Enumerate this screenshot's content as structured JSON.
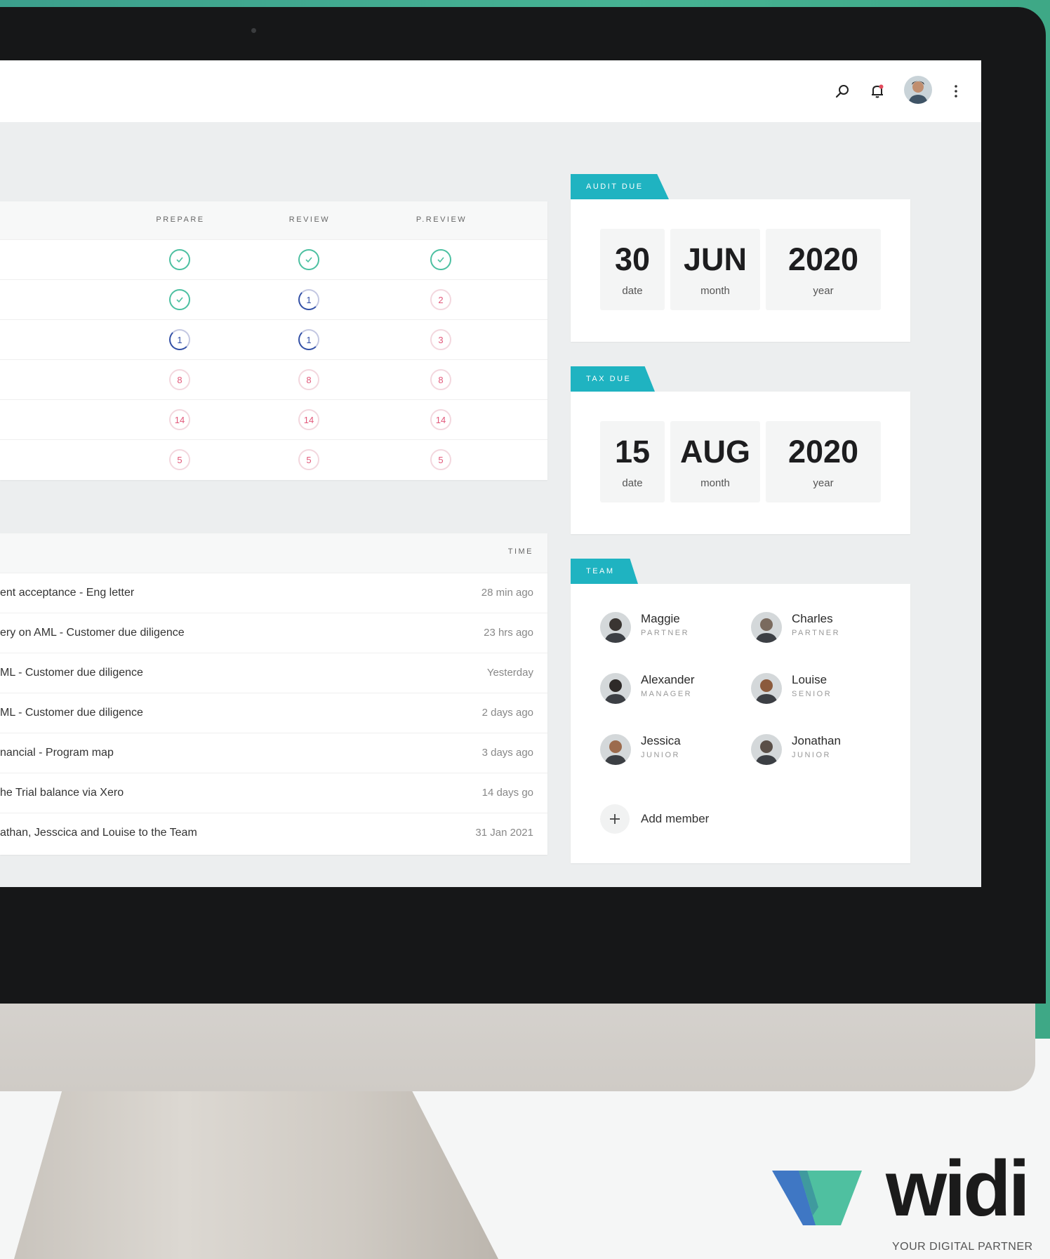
{
  "header": {
    "icons": [
      "search-icon",
      "bell-icon",
      "user-avatar",
      "more-vertical-icon"
    ]
  },
  "status_table": {
    "columns": [
      "PREPARE",
      "REVIEW",
      "P.REVIEW"
    ],
    "rows": [
      [
        {
          "type": "done",
          "label": ""
        },
        {
          "type": "done",
          "label": ""
        },
        {
          "type": "done",
          "label": ""
        }
      ],
      [
        {
          "type": "done",
          "label": ""
        },
        {
          "type": "progress",
          "label": "1"
        },
        {
          "type": "count",
          "label": "2"
        }
      ],
      [
        {
          "type": "progress",
          "label": "1"
        },
        {
          "type": "progress",
          "label": "1"
        },
        {
          "type": "count",
          "label": "3"
        }
      ],
      [
        {
          "type": "count",
          "label": "8"
        },
        {
          "type": "count",
          "label": "8"
        },
        {
          "type": "count",
          "label": "8"
        }
      ],
      [
        {
          "type": "count",
          "label": "14"
        },
        {
          "type": "count",
          "label": "14"
        },
        {
          "type": "count",
          "label": "14"
        }
      ],
      [
        {
          "type": "count",
          "label": "5"
        },
        {
          "type": "count",
          "label": "5"
        },
        {
          "type": "count",
          "label": "5"
        }
      ]
    ]
  },
  "activity": {
    "time_header": "TIME",
    "items": [
      {
        "text": "ent acceptance - Eng letter",
        "time": "28 min ago"
      },
      {
        "text": "ery on AML - Customer due diligence",
        "time": "23 hrs ago"
      },
      {
        "text": "ML - Customer due diligence",
        "time": "Yesterday"
      },
      {
        "text": "ML - Customer due diligence",
        "time": "2 days ago"
      },
      {
        "text": "nancial - Program map",
        "time": "3 days ago"
      },
      {
        "text": "he Trial balance via Xero",
        "time": "14 days go"
      },
      {
        "text": "athan, Jesscica and Louise to the Team",
        "time": "31 Jan 2021"
      }
    ]
  },
  "audit_due": {
    "tag": "AUDIT DUE",
    "date": "30",
    "date_label": "date",
    "month": "JUN",
    "month_label": "month",
    "year": "2020",
    "year_label": "year"
  },
  "tax_due": {
    "tag": "TAX DUE",
    "date": "15",
    "date_label": "date",
    "month": "AUG",
    "month_label": "month",
    "year": "2020",
    "year_label": "year"
  },
  "team": {
    "tag": "TEAM",
    "members": [
      {
        "name": "Maggie",
        "role": "PARTNER",
        "color": "#3a3532"
      },
      {
        "name": "Charles",
        "role": "PARTNER",
        "color": "#7a6a5e"
      },
      {
        "name": "Alexander",
        "role": "MANAGER",
        "color": "#2e2a28"
      },
      {
        "name": "Louise",
        "role": "SENIOR",
        "color": "#8b5a3c"
      },
      {
        "name": "Jessica",
        "role": "JUNIOR",
        "color": "#9c6b4d"
      },
      {
        "name": "Jonathan",
        "role": "JUNIOR",
        "color": "#5a4f48"
      }
    ],
    "add_label": "Add member"
  },
  "brand": {
    "name": "widi",
    "tagline": "YOUR DIGITAL PARTNER",
    "colors": {
      "blue": "#3f77c4",
      "teal": "#4fc0a0",
      "green": "#46b393"
    }
  }
}
